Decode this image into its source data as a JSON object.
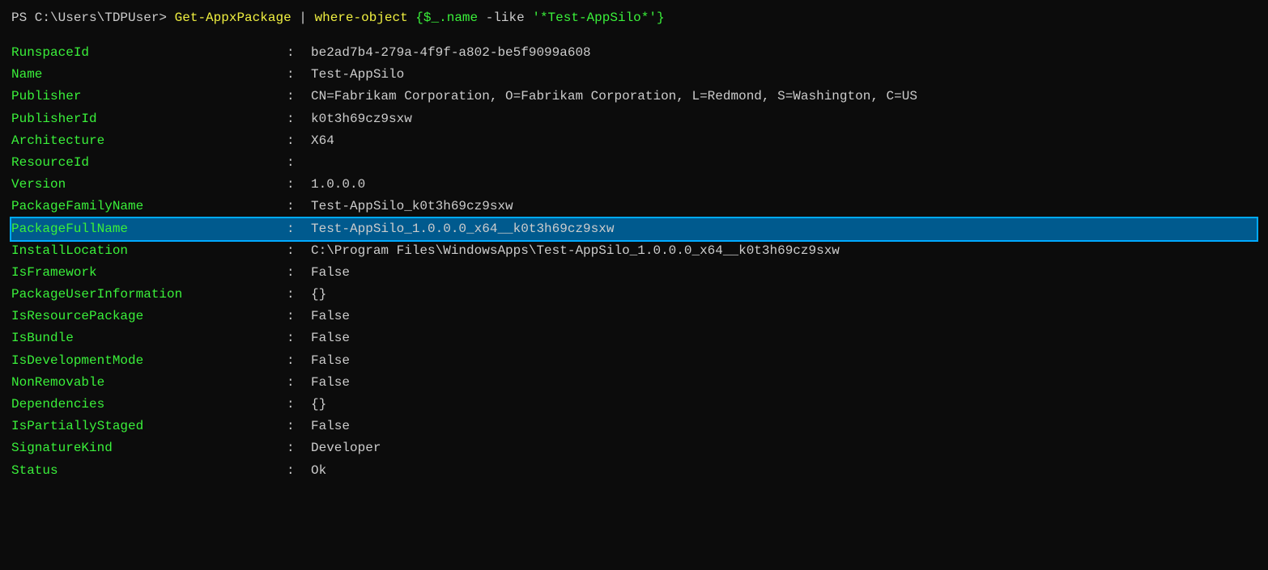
{
  "terminal": {
    "command_line": {
      "prompt": "PS C:\\Users\\TDPUser> ",
      "part1": "Get-AppxPackage",
      "pipe": " | ",
      "part2": "where-object",
      "brace_open": " {",
      "dollar_var": "$_",
      "dot_name": ".name",
      "operator": " -like ",
      "filter_string": "'*Test-AppSilo*'",
      "brace_close": "}"
    },
    "properties": [
      {
        "name": "RunspaceId",
        "value": "be2ad7b4-279a-4f9f-a802-be5f9099a608",
        "highlighted": false
      },
      {
        "name": "Name",
        "value": "Test-AppSilo",
        "highlighted": false
      },
      {
        "name": "Publisher",
        "value": "CN=Fabrikam Corporation, O=Fabrikam Corporation, L=Redmond, S=Washington, C=US",
        "highlighted": false
      },
      {
        "name": "PublisherId",
        "value": "k0t3h69cz9sxw",
        "highlighted": false
      },
      {
        "name": "Architecture",
        "value": "X64",
        "highlighted": false
      },
      {
        "name": "ResourceId",
        "value": "",
        "highlighted": false
      },
      {
        "name": "Version",
        "value": "1.0.0.0",
        "highlighted": false
      },
      {
        "name": "PackageFamilyName",
        "value": "Test-AppSilo_k0t3h69cz9sxw",
        "highlighted": false
      },
      {
        "name": "PackageFullName",
        "value": "Test-AppSilo_1.0.0.0_x64__k0t3h69cz9sxw",
        "highlighted": true
      },
      {
        "name": "InstallLocation",
        "value": "C:\\Program Files\\WindowsApps\\Test-AppSilo_1.0.0.0_x64__k0t3h69cz9sxw",
        "highlighted": false
      },
      {
        "name": "IsFramework",
        "value": "False",
        "highlighted": false
      },
      {
        "name": "PackageUserInformation",
        "value": "{}",
        "highlighted": false
      },
      {
        "name": "IsResourcePackage",
        "value": "False",
        "highlighted": false
      },
      {
        "name": "IsBundle",
        "value": "False",
        "highlighted": false
      },
      {
        "name": "IsDevelopmentMode",
        "value": "False",
        "highlighted": false
      },
      {
        "name": "NonRemovable",
        "value": "False",
        "highlighted": false
      },
      {
        "name": "Dependencies",
        "value": "{}",
        "highlighted": false
      },
      {
        "name": "IsPartiallyStaged",
        "value": "False",
        "highlighted": false
      },
      {
        "name": "SignatureKind",
        "value": "Developer",
        "highlighted": false
      },
      {
        "name": "Status",
        "value": "Ok",
        "highlighted": false
      }
    ],
    "labels": {
      "colon": " : "
    }
  }
}
